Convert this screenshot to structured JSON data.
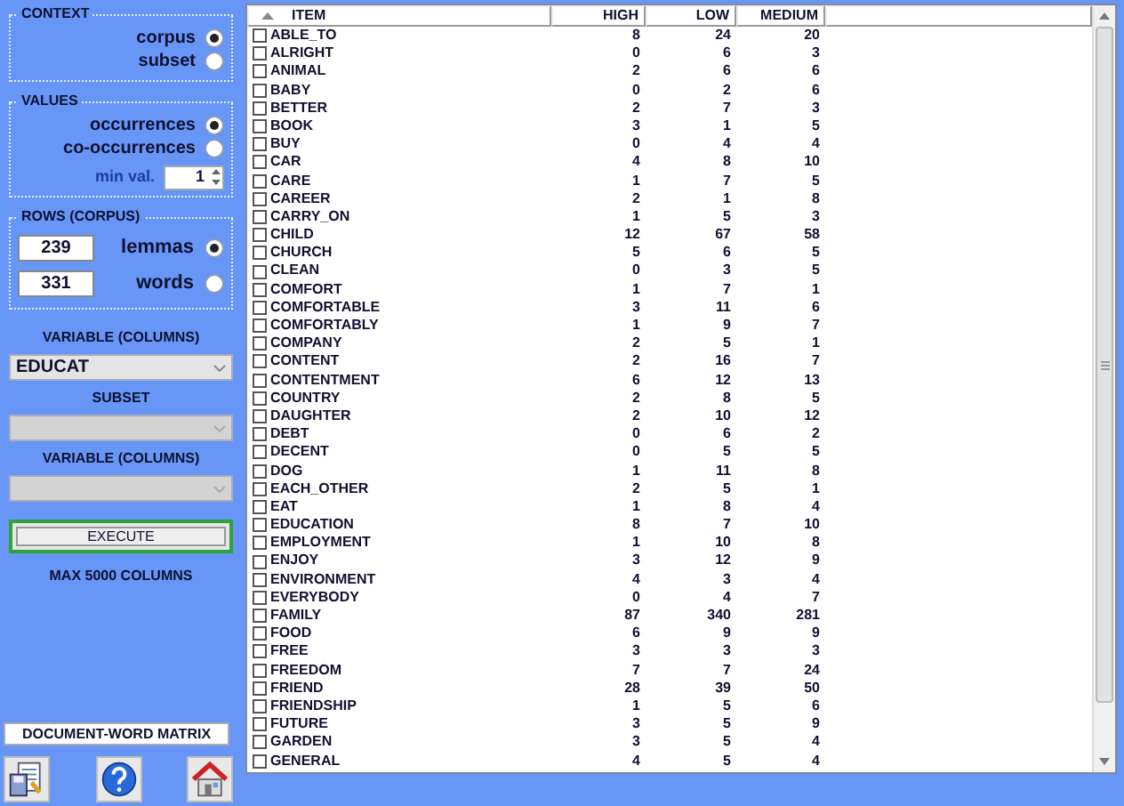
{
  "context": {
    "title": "CONTEXT",
    "options": [
      {
        "label": "corpus",
        "selected": true
      },
      {
        "label": "subset",
        "selected": false
      }
    ]
  },
  "values": {
    "title": "VALUES",
    "options": [
      {
        "label": "occurrences",
        "selected": true
      },
      {
        "label": "co-occurrences",
        "selected": false
      }
    ],
    "min_val": {
      "label": "min val.",
      "value": "1"
    }
  },
  "rows_corpus": {
    "title": "ROWS (CORPUS)",
    "options": [
      {
        "count": "239",
        "label": "lemmas",
        "selected": true
      },
      {
        "count": "331",
        "label": "words",
        "selected": false
      }
    ]
  },
  "selectors": [
    {
      "label": "VARIABLE (COLUMNS)",
      "value": "EDUCAT",
      "disabled": false
    },
    {
      "label": "SUBSET",
      "disabled": true
    },
    {
      "label": "VARIABLE (COLUMNS)",
      "disabled": true
    }
  ],
  "execute_button": "EXECUTE",
  "note": "MAX 5000 COLUMNS",
  "matrix_button": "DOCUMENT-WORD MATRIX",
  "table": {
    "columns": [
      "ITEM",
      "HIGH",
      "LOW",
      "MEDIUM"
    ],
    "rows": [
      {
        "item": "ABLE_TO",
        "checked": false,
        "values": [
          "8",
          "24",
          "20"
        ]
      },
      {
        "item": "ALRIGHT",
        "checked": false,
        "values": [
          "0",
          "6",
          "3"
        ]
      },
      {
        "item": "ANIMAL",
        "checked": false,
        "values": [
          "2",
          "6",
          "6"
        ]
      },
      {
        "item": "BABY",
        "checked": false,
        "values": [
          "0",
          "2",
          "6"
        ]
      },
      {
        "item": "BETTER",
        "checked": false,
        "values": [
          "2",
          "7",
          "3"
        ]
      },
      {
        "item": "BOOK",
        "checked": false,
        "values": [
          "3",
          "1",
          "5"
        ]
      },
      {
        "item": "BUY",
        "checked": false,
        "values": [
          "0",
          "4",
          "4"
        ]
      },
      {
        "item": "CAR",
        "checked": false,
        "values": [
          "4",
          "8",
          "10"
        ]
      },
      {
        "item": "CARE",
        "checked": false,
        "values": [
          "1",
          "7",
          "5"
        ]
      },
      {
        "item": "CAREER",
        "checked": false,
        "values": [
          "2",
          "1",
          "8"
        ]
      },
      {
        "item": "CARRY_ON",
        "checked": false,
        "values": [
          "1",
          "5",
          "3"
        ]
      },
      {
        "item": "CHILD",
        "checked": false,
        "values": [
          "12",
          "67",
          "58"
        ]
      },
      {
        "item": "CHURCH",
        "checked": false,
        "values": [
          "5",
          "6",
          "5"
        ]
      },
      {
        "item": "CLEAN",
        "checked": false,
        "values": [
          "0",
          "3",
          "5"
        ]
      },
      {
        "item": "COMFORT",
        "checked": false,
        "values": [
          "1",
          "7",
          "1"
        ]
      },
      {
        "item": "COMFORTABLE",
        "checked": false,
        "values": [
          "3",
          "11",
          "6"
        ]
      },
      {
        "item": "COMFORTABLY",
        "checked": false,
        "values": [
          "1",
          "9",
          "7"
        ]
      },
      {
        "item": "COMPANY",
        "checked": false,
        "values": [
          "2",
          "5",
          "1"
        ]
      },
      {
        "item": "CONTENT",
        "checked": false,
        "values": [
          "2",
          "16",
          "7"
        ]
      },
      {
        "item": "CONTENTMENT",
        "checked": false,
        "values": [
          "6",
          "12",
          "13"
        ]
      },
      {
        "item": "COUNTRY",
        "checked": false,
        "values": [
          "2",
          "8",
          "5"
        ]
      },
      {
        "item": "DAUGHTER",
        "checked": false,
        "values": [
          "2",
          "10",
          "12"
        ]
      },
      {
        "item": "DEBT",
        "checked": false,
        "values": [
          "0",
          "6",
          "2"
        ]
      },
      {
        "item": "DECENT",
        "checked": false,
        "values": [
          "0",
          "5",
          "5"
        ]
      },
      {
        "item": "DOG",
        "checked": false,
        "values": [
          "1",
          "11",
          "8"
        ]
      },
      {
        "item": "EACH_OTHER",
        "checked": false,
        "values": [
          "2",
          "5",
          "1"
        ]
      },
      {
        "item": "EAT",
        "checked": false,
        "values": [
          "1",
          "8",
          "4"
        ]
      },
      {
        "item": "EDUCATION",
        "checked": false,
        "values": [
          "8",
          "7",
          "10"
        ]
      },
      {
        "item": "EMPLOYMENT",
        "checked": false,
        "values": [
          "1",
          "10",
          "8"
        ]
      },
      {
        "item": "ENJOY",
        "checked": false,
        "values": [
          "3",
          "12",
          "9"
        ]
      },
      {
        "item": "ENVIRONMENT",
        "checked": false,
        "values": [
          "4",
          "3",
          "4"
        ]
      },
      {
        "item": "EVERYBODY",
        "checked": false,
        "values": [
          "0",
          "4",
          "7"
        ]
      },
      {
        "item": "FAMILY",
        "checked": false,
        "values": [
          "87",
          "340",
          "281"
        ]
      },
      {
        "item": "FOOD",
        "checked": false,
        "values": [
          "6",
          "9",
          "9"
        ]
      },
      {
        "item": "FREE",
        "checked": false,
        "values": [
          "3",
          "3",
          "3"
        ]
      },
      {
        "item": "FREEDOM",
        "checked": false,
        "values": [
          "7",
          "7",
          "24"
        ]
      },
      {
        "item": "FRIEND",
        "checked": false,
        "values": [
          "28",
          "39",
          "50"
        ]
      },
      {
        "item": "FRIENDSHIP",
        "checked": false,
        "values": [
          "1",
          "5",
          "6"
        ]
      },
      {
        "item": "FUTURE",
        "checked": false,
        "values": [
          "3",
          "5",
          "9"
        ]
      },
      {
        "item": "GARDEN",
        "checked": false,
        "values": [
          "3",
          "5",
          "4"
        ]
      },
      {
        "item": "GENERAL",
        "checked": false,
        "values": [
          "4",
          "5",
          "4"
        ]
      }
    ]
  }
}
